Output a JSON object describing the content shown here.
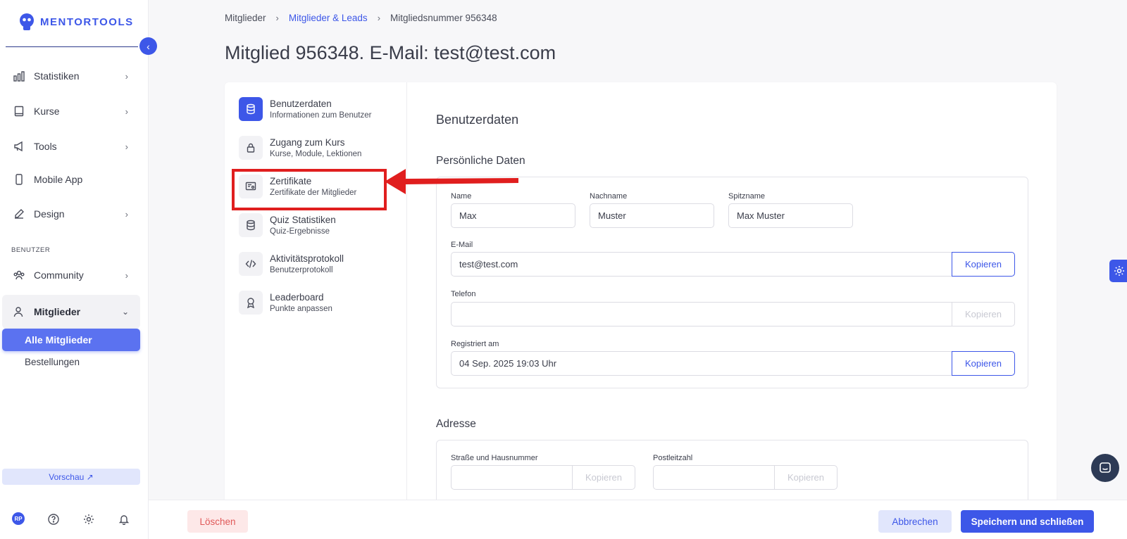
{
  "brand": {
    "name": "MENTORTOOLS",
    "accent": "#3d57e8"
  },
  "sidebar": {
    "items": [
      {
        "label": "Statistiken",
        "icon": "bar-chart-icon"
      },
      {
        "label": "Kurse",
        "icon": "book-icon"
      },
      {
        "label": "Tools",
        "icon": "megaphone-icon"
      },
      {
        "label": "Mobile App",
        "icon": "phone-icon"
      },
      {
        "label": "Design",
        "icon": "pen-icon"
      }
    ],
    "section_label": "BENUTZER",
    "community": {
      "label": "Community",
      "icon": "users-icon"
    },
    "members": {
      "label": "Mitglieder",
      "icon": "user-icon"
    },
    "sub_active": "Alle Mitglieder",
    "sub_item": "Bestellungen",
    "preview": "Vorschau ↗",
    "avatar": "RP"
  },
  "breadcrumb": {
    "root": "Mitglieder",
    "middle": "Mitglieder & Leads",
    "current": "Mitgliedsnummer 956348"
  },
  "page_title": "Mitglied 956348. E-Mail: test@test.com",
  "tabs": [
    {
      "title": "Benutzerdaten",
      "sub": "Informationen zum Benutzer",
      "icon": "database-icon"
    },
    {
      "title": "Zugang zum Kurs",
      "sub": "Kurse, Module, Lektionen",
      "icon": "lock-icon"
    },
    {
      "title": "Zertifikate",
      "sub": "Zertifikate der Mitglieder",
      "icon": "certificate-icon"
    },
    {
      "title": "Quiz Statistiken",
      "sub": "Quiz-Ergebnisse",
      "icon": "database-icon"
    },
    {
      "title": "Aktivitätsprotokoll",
      "sub": "Benutzerprotokoll",
      "icon": "code-icon"
    },
    {
      "title": "Leaderboard",
      "sub": "Punkte anpassen",
      "icon": "award-icon"
    }
  ],
  "content": {
    "title": "Benutzerdaten",
    "personal": {
      "title": "Persönliche Daten",
      "name_label": "Name",
      "name_value": "Max",
      "lastname_label": "Nachname",
      "lastname_value": "Muster",
      "nickname_label": "Spitzname",
      "nickname_value": "Max Muster",
      "email_label": "E-Mail",
      "email_value": "test@test.com",
      "phone_label": "Telefon",
      "phone_value": "",
      "registered_label": "Registriert am",
      "registered_value": "04 Sep. 2025 19:03 Uhr",
      "copy_label": "Kopieren"
    },
    "address": {
      "title": "Adresse",
      "street_label": "Straße und Hausnummer",
      "zip_label": "Postleitzahl",
      "copy_label": "Kopieren"
    }
  },
  "footer": {
    "delete": "Löschen",
    "cancel": "Abbrechen",
    "save": "Speichern und schließen"
  }
}
